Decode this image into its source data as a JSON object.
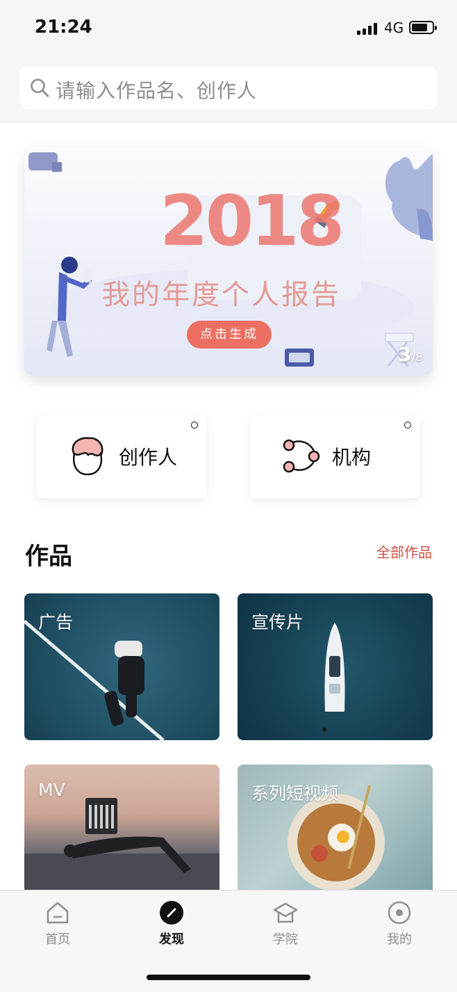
{
  "status_bar": {
    "time": "21:24",
    "network": "4G"
  },
  "search": {
    "placeholder": "请输入作品名、创作人"
  },
  "banner": {
    "year": "2018",
    "title": "我的年度个人报告",
    "button_label": "点击生成",
    "page_current": "3",
    "page_total": "/8"
  },
  "quick_entries": [
    {
      "label": "创作人",
      "icon": "creator-face-icon"
    },
    {
      "label": "机构",
      "icon": "organization-network-icon"
    }
  ],
  "works_section": {
    "title": "作品",
    "more_label": "全部作品",
    "categories": [
      {
        "label": "广告"
      },
      {
        "label": "宣传片"
      },
      {
        "label": "MV"
      },
      {
        "label": "系列短视频"
      }
    ]
  },
  "tabbar": {
    "items": [
      {
        "label": "首页",
        "icon": "home-icon"
      },
      {
        "label": "发现",
        "icon": "discover-icon",
        "active": true
      },
      {
        "label": "学院",
        "icon": "academy-icon"
      },
      {
        "label": "我的",
        "icon": "profile-icon"
      }
    ]
  },
  "colors": {
    "accent_red": "#d34e3e",
    "banner_button": "#ec6f62",
    "year_pink": "#ec7770",
    "active_tab": "#111111",
    "inactive_tab": "#8e8e8e"
  }
}
